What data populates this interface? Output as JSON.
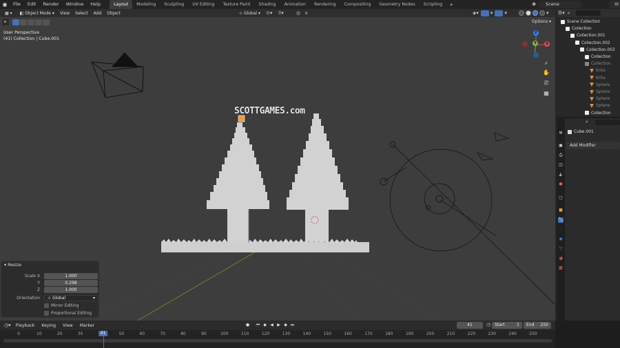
{
  "menubar": {
    "menus": [
      "File",
      "Edit",
      "Render",
      "Window",
      "Help"
    ],
    "workspaces": [
      "Layout",
      "Modeling",
      "Sculpting",
      "UV Editing",
      "Texture Paint",
      "Shading",
      "Animation",
      "Rendering",
      "Compositing",
      "Geometry Nodes",
      "Scripting"
    ],
    "active_workspace": "Layout",
    "add_workspace": "+",
    "scene": "Scene",
    "view_layer": "Vi"
  },
  "viewport": {
    "mode": "Object Mode",
    "menus": [
      "View",
      "Select",
      "Add",
      "Object"
    ],
    "orientation": "Global",
    "options": "Options",
    "info_line1": "User Perspective",
    "info_line2": "(41) Collection | Cube.001",
    "watermark": "SCOTTGAMES.com",
    "gizmo": {
      "z": "Z",
      "y": "Y",
      "x": "X"
    }
  },
  "resize_panel": {
    "title": "Resize",
    "scale_x_label": "Scale X",
    "scale_y_label": "Y",
    "scale_z_label": "Z",
    "scale_x": "1.000",
    "scale_y": "0.298",
    "scale_z": "1.000",
    "orientation_label": "Orientation",
    "orientation_value": "Global",
    "mirror_editing": "Mirror Editing",
    "proportional_editing": "Proportional Editing"
  },
  "outliner": {
    "rows": [
      {
        "label": "Scene Collection",
        "icon": "scene-collection-icon",
        "indent": 0,
        "dim": false
      },
      {
        "label": "Collection",
        "icon": "collection-icon",
        "indent": 1,
        "dim": false
      },
      {
        "label": "Collection.001",
        "icon": "collection-icon",
        "indent": 2,
        "dim": false
      },
      {
        "label": "Collection.002",
        "icon": "collection-icon",
        "indent": 3,
        "dim": false
      },
      {
        "label": "Collection.003",
        "icon": "collection-icon",
        "indent": 4,
        "dim": false
      },
      {
        "label": "Collection",
        "icon": "collection-icon",
        "indent": 5,
        "dim": false
      },
      {
        "label": "Collection",
        "icon": "collection-icon",
        "indent": 5,
        "dim": true
      },
      {
        "label": "Krita",
        "icon": "cone-icon",
        "indent": 6,
        "dim": true
      },
      {
        "label": "Krita",
        "icon": "cone-icon",
        "indent": 6,
        "dim": true
      },
      {
        "label": "Sphere",
        "icon": "cone-icon",
        "indent": 6,
        "dim": true
      },
      {
        "label": "Sphere",
        "icon": "cone-icon",
        "indent": 6,
        "dim": true
      },
      {
        "label": "Sphere",
        "icon": "cone-icon",
        "indent": 6,
        "dim": true
      },
      {
        "label": "Sphere",
        "icon": "cone-icon",
        "indent": 6,
        "dim": true
      },
      {
        "label": "Collection",
        "icon": "collection-icon",
        "indent": 5,
        "dim": false
      }
    ]
  },
  "properties": {
    "object_name": "Cube.001",
    "add_modifier": "Add Modifier"
  },
  "timeline": {
    "menus": [
      "Playback",
      "Keying",
      "View",
      "Marker"
    ],
    "current_frame": "41",
    "start_label": "Start",
    "start_value": "1",
    "end_label": "End",
    "end_value": "250",
    "ticks": [
      "0",
      "10",
      "20",
      "30",
      "40",
      "50",
      "60",
      "70",
      "80",
      "90",
      "100",
      "110",
      "120",
      "130",
      "140",
      "150",
      "160",
      "170",
      "180",
      "190",
      "200",
      "210",
      "220",
      "230",
      "240",
      "250"
    ]
  },
  "colors": {
    "accent": "#4772b3",
    "axis_x": "#e5465b",
    "axis_y": "#7fb23a",
    "axis_z": "#3c82e0"
  }
}
